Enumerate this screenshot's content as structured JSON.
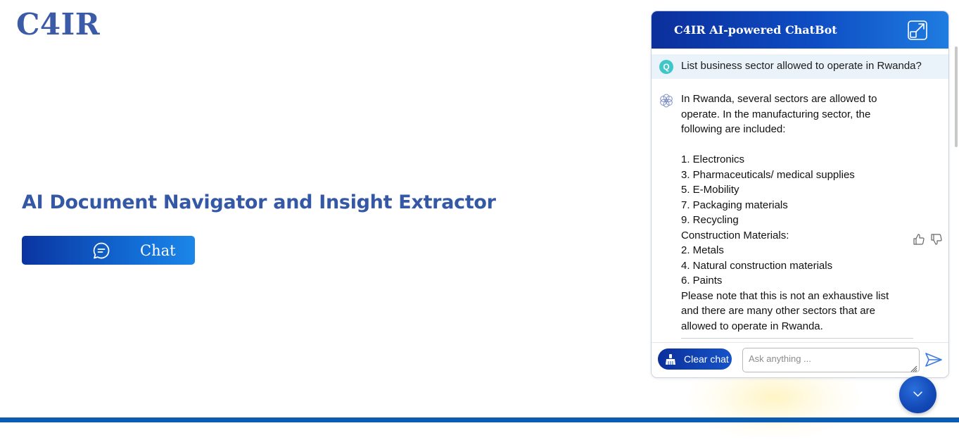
{
  "brand": {
    "logo_text": "C4IR"
  },
  "hero": {
    "title": "AI Document Navigator and Insight Extractor",
    "chat_button_label": "Chat"
  },
  "chatbot": {
    "header_title": "C4IR AI-powered ChatBot",
    "question_badge": "Q",
    "question": "List business sector allowed to operate in Rwanda?",
    "answer_lines": [
      "In Rwanda, several sectors are allowed to",
      "operate. In the manufacturing sector, the",
      "following are included:",
      "",
      "1. Electronics",
      "3. Pharmaceuticals/ medical supplies",
      "5. E-Mobility",
      "7. Packaging materials",
      "9. Recycling",
      "Construction Materials:",
      "2. Metals",
      "4. Natural construction materials",
      "6. Paints",
      "Please note that this is not an exhaustive list",
      "and there are many other sectors that are",
      "allowed to operate in Rwanda."
    ],
    "clear_button_label": "Clear chat",
    "input_placeholder": "Ask anything ...",
    "icons": {
      "expand": "expand-icon",
      "bot": "bot-flower-icon",
      "thumbs_up": "thumbs-up-icon",
      "thumbs_down": "thumbs-down-icon",
      "broom": "broom-icon",
      "send": "send-icon",
      "chevron": "chevron-down-icon"
    }
  },
  "colors": {
    "brand_blue": "#3558a6",
    "header_gradient_start": "#0b2f9b",
    "header_gradient_end": "#1f7ce0",
    "question_bg": "#eaf3fa",
    "q_badge": "#3fc6c8",
    "bottom_bar": "#0b5db3"
  }
}
